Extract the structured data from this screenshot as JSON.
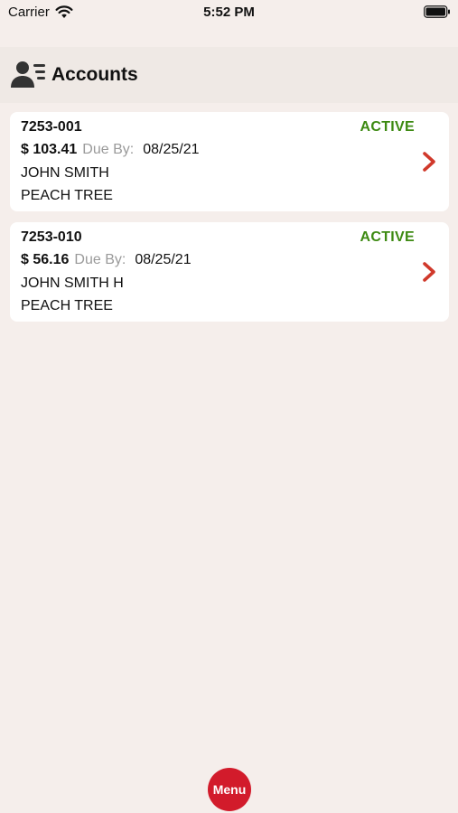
{
  "status_bar": {
    "carrier": "Carrier",
    "time": "5:52 PM",
    "wifi_icon": "wifi-icon",
    "battery_icon": "battery-icon"
  },
  "header": {
    "icon": "accounts-icon",
    "title": "Accounts"
  },
  "accounts": [
    {
      "number": "7253-001",
      "status": "ACTIVE",
      "amount": "$ 103.41",
      "due_label": "Due By:",
      "due_date": "08/25/21",
      "name": "JOHN SMITH",
      "location": "PEACH TREE"
    },
    {
      "number": "7253-010",
      "status": "ACTIVE",
      "amount": "$ 56.16",
      "due_label": "Due By:",
      "due_date": "08/25/21",
      "name": "JOHN SMITH H",
      "location": "PEACH TREE"
    }
  ],
  "menu": {
    "label": "Menu"
  },
  "colors": {
    "background": "#f5eeeb",
    "header_bg": "#efe9e5",
    "status_active": "#3d8a12",
    "chevron": "#d0392b",
    "menu_button": "#d21b2b",
    "due_label": "#9a9a9a"
  }
}
